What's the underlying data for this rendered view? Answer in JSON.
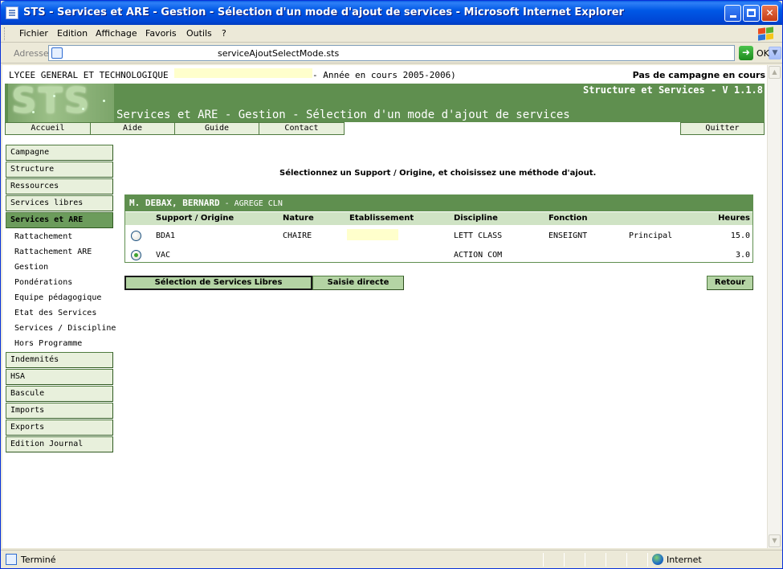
{
  "window": {
    "title": "STS - Services et ARE - Gestion - Sélection d'un mode d'ajout de services - Microsoft Internet Explorer"
  },
  "menu": {
    "items": [
      "Fichier",
      "Edition",
      "Affichage",
      "Favoris",
      "Outils",
      "?"
    ]
  },
  "address": {
    "label": "Adresse",
    "url": "serviceAjoutSelectMode.sts",
    "go_label": "OK"
  },
  "status": {
    "text": "Terminé",
    "zone": "Internet"
  },
  "page": {
    "school": "LYCEE GENERAL ET TECHNOLOGIQUE",
    "year": "- Année en cours 2005-2006)",
    "campaign": "Pas de campagne en cours",
    "version": "Structure et Services - V 1.1.8",
    "title": "Services et ARE - Gestion - Sélection d'un mode d'ajout de services",
    "logo_text": "STS",
    "instruction": "Sélectionnez un Support / Origine, et choisissez une méthode d'ajout."
  },
  "topnav": {
    "accueil": "Accueil",
    "aide": "Aide",
    "guide": "Guide",
    "contact": "Contact",
    "quitter": "Quitter"
  },
  "leftmenu": {
    "campagne": "Campagne",
    "structure": "Structure",
    "ressources": "Ressources",
    "services_libres": "Services libres",
    "services_are": "Services et ARE",
    "sub": {
      "rattachement": "Rattachement",
      "rattachement_are": "Rattachement ARE",
      "gestion": "Gestion",
      "ponderations": "Pondérations",
      "equipe": "Equipe pédagogique",
      "etat": "Etat des Services",
      "services_discipline": "Services / Discipline",
      "hors_programme": "Hors Programme"
    },
    "indemnites": "Indemnités",
    "hsa": "HSA",
    "bascule": "Bascule",
    "imports": "Imports",
    "exports": "Exports",
    "edition_journal": "Edition Journal"
  },
  "panel": {
    "person": "M. DEBAX, BERNARD",
    "grade": "- AGREGE CLN",
    "columns": {
      "support": "Support / Origine",
      "nature": "Nature",
      "etablissement": "Etablissement",
      "discipline": "Discipline",
      "fonction": "Fonction",
      "heures": "Heures"
    },
    "rows": [
      {
        "support": "BDA1",
        "nature": "CHAIRE",
        "discipline": "LETT CLASS",
        "fonction": "ENSEIGNT",
        "extra": "Principal",
        "heures": "15.0",
        "selected": false
      },
      {
        "support": "VAC",
        "nature": "",
        "discipline": "ACTION COM",
        "fonction": "",
        "extra": "",
        "heures": "3.0",
        "selected": true
      }
    ]
  },
  "actions": {
    "selection_libres": "Sélection de Services Libres",
    "saisie_directe": "Saisie directe",
    "retour": "Retour"
  }
}
